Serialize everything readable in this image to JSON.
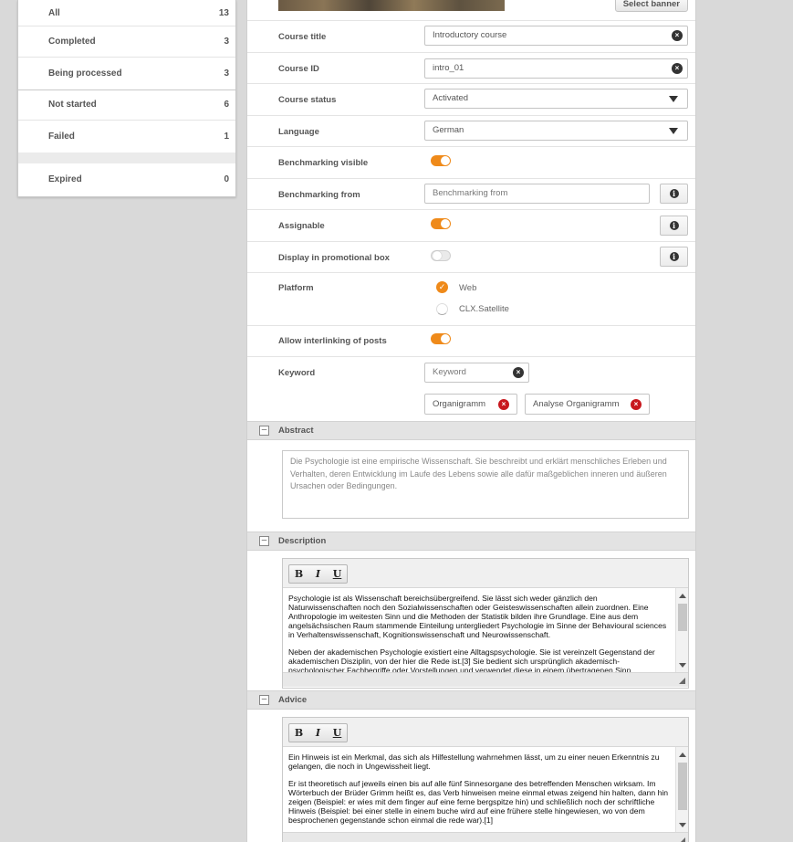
{
  "sidebar": {
    "items": [
      {
        "label": "All",
        "count": "13"
      },
      {
        "label": "Completed",
        "count": "3"
      },
      {
        "label": "Being processed",
        "count": "3"
      },
      {
        "label": "Not started",
        "count": "6"
      },
      {
        "label": "Failed",
        "count": "1"
      },
      {
        "label": "Expired",
        "count": "0"
      }
    ]
  },
  "form": {
    "select_banner_label": "Select banner",
    "course_title": {
      "label": "Course title",
      "value": "Introductory course"
    },
    "course_id": {
      "label": "Course ID",
      "value": "intro_01"
    },
    "course_status": {
      "label": "Course status",
      "value": "Activated"
    },
    "language": {
      "label": "Language",
      "value": "German"
    },
    "benchmarking_visible": {
      "label": "Benchmarking visible",
      "on": true
    },
    "benchmarking_from": {
      "label": "Benchmarking from",
      "placeholder": "Benchmarking from"
    },
    "assignable": {
      "label": "Assignable",
      "on": true
    },
    "promo_box": {
      "label": "Display in promotional box",
      "on": false
    },
    "platform": {
      "label": "Platform",
      "options": [
        {
          "label": "Web",
          "checked": true
        },
        {
          "label": "CLX.Satellite",
          "checked": false
        }
      ]
    },
    "interlinking": {
      "label": "Allow interlinking of posts",
      "on": true
    },
    "keyword": {
      "label": "Keyword",
      "placeholder": "Keyword",
      "tags": [
        "Organigramm",
        "Analyse Organigramm"
      ]
    }
  },
  "abstract": {
    "title": "Abstract",
    "text": "Die Psychologie ist eine empirische Wissenschaft. Sie beschreibt und erklärt menschliches Erleben und Verhalten, deren Entwicklung im Laufe des Lebens sowie alle dafür maßgeblichen inneren und äußeren Ursachen oder Bedingungen."
  },
  "description": {
    "title": "Description",
    "toolbar": {
      "bold": "B",
      "italic": "I",
      "underline": "U"
    },
    "p1": "Psychologie ist als Wissenschaft bereichsübergreifend. Sie lässt sich weder gänzlich den Naturwissenschaften noch den Sozialwissenschaften oder Geisteswissenschaften allein zuordnen. Eine Anthropologie im weitesten Sinn und die Methoden der Statistik bilden ihre Grundlage. Eine aus dem angelsächsischen Raum stammende Einteilung untergliedert Psychologie im Sinne der Behavioural sciences in Verhaltenswissenschaft, Kognitionswissenschaft und Neurowissenschaft.",
    "p2": "Neben der akademischen Psychologie existiert eine Alltagspsychologie. Sie ist vereinzelt Gegenstand der akademischen Disziplin, von der hier die Rede ist.[3] Sie bedient sich ursprünglich akademisch-psychologischer Fachbegriffe oder Vorstellungen und verwendet diese in einem übertragenen Sinn."
  },
  "advice": {
    "title": "Advice",
    "toolbar": {
      "bold": "B",
      "italic": "I",
      "underline": "U"
    },
    "p1": "Ein Hinweis ist ein Merkmal, das sich als Hilfestellung wahrnehmen lässt, um zu einer neuen Erkenntnis zu gelangen, die noch in Ungewissheit liegt.",
    "p2": "Er ist theoretisch auf jeweils einen bis auf alle fünf Sinnesorgane des betreffenden Menschen wirksam. Im Wörterbuch der Brüder Grimm heißt es, das Verb hinweisen meine einmal etwas zeigend hin halten, dann hin zeigen (Beispiel: er wies mit dem finger auf eine ferne bergspitze hin) und schließlich noch der schriftliche Hinweis (Beispiel: bei einer stelle in einem buche wird auf eine frühere stelle hingewiesen, wo von dem besprochenen gegenstande schon einmal die rede war).[1]"
  },
  "colors": {
    "accent": "#ef8a1a",
    "remove": "#c8181e"
  }
}
